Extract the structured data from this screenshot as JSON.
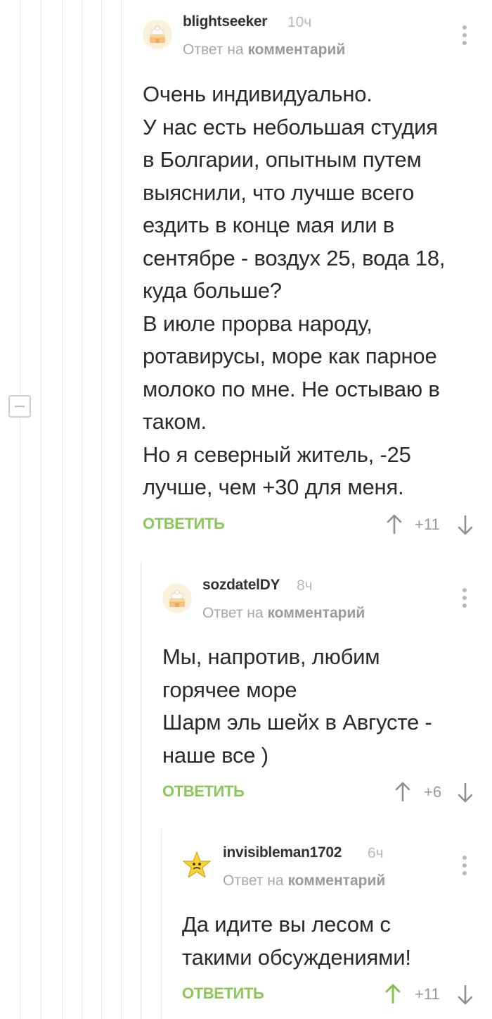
{
  "colors": {
    "accent": "#8ac858",
    "text": "#2b2b2b",
    "muted": "#a8a8a8",
    "thread_line": "#e8e8e8"
  },
  "comments": [
    {
      "username": "blightseeker",
      "time": "10ч",
      "reply_prefix": "Ответ на",
      "reply_target": "комментарий",
      "text": "Очень индивидуально.\nУ нас есть небольшая студия\nв Болгарии, опытным путем\nвыяснили, что лучше всего\nездить в конце мая или в\nсентябре - воздух 25, вода 18,\nкуда больше?\nВ июле прорва народу,\nротавирусы, море как парное\nмолоко по мне. Не остываю в\nтаком.\nНо я северный житель, -25\nлучше, чем +30 для меня.",
      "reply_label": "ОТВЕТИТЬ",
      "rating": "+11",
      "avatar_icon": "cake-icon"
    },
    {
      "username": "sozdatelDY",
      "time": "8ч",
      "reply_prefix": "Ответ на",
      "reply_target": "комментарий",
      "text": "Мы, напротив, любим\nгорячее море\nШарм эль шейх в Августе -\nнаше все )",
      "reply_label": "ОТВЕТИТЬ",
      "rating": "+6",
      "avatar_icon": "cake-icon"
    },
    {
      "username": "invisibleman1702",
      "time": "6ч",
      "reply_prefix": "Ответ на",
      "reply_target": "комментарий",
      "text": "Да идите вы лесом с\nтакими обсуждениями!",
      "reply_label": "ОТВЕТИТЬ",
      "rating": "+11",
      "upvoted": true,
      "avatar_icon": "star-icon"
    }
  ]
}
